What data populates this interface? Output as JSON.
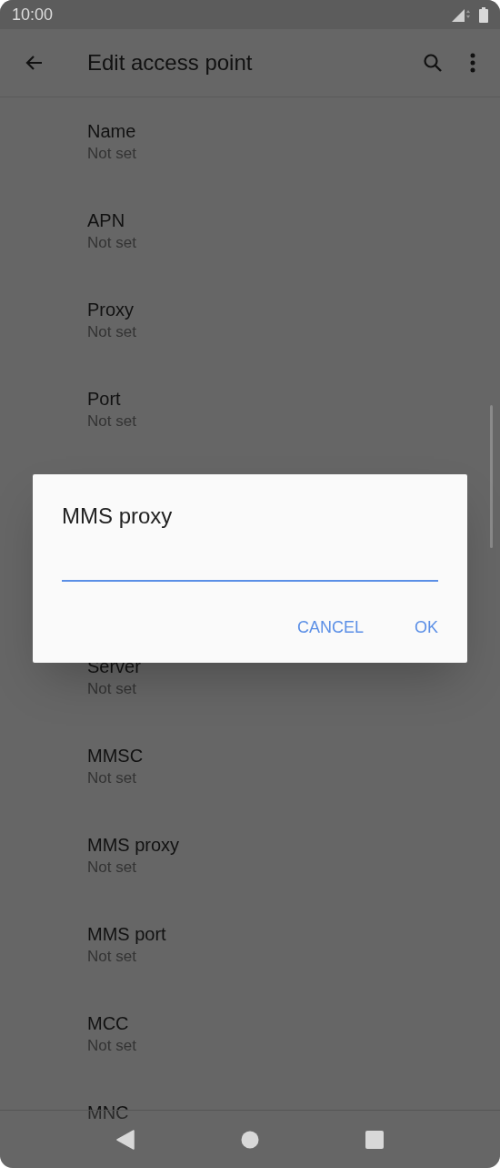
{
  "status_bar": {
    "time": "10:00"
  },
  "app_bar": {
    "title": "Edit access point"
  },
  "settings": [
    {
      "title": "Name",
      "summary": "Not set"
    },
    {
      "title": "APN",
      "summary": "Not set"
    },
    {
      "title": "Proxy",
      "summary": "Not set"
    },
    {
      "title": "Port",
      "summary": "Not set"
    }
  ],
  "settings_below_dialog": [
    {
      "title": "Server",
      "summary": "Not set"
    },
    {
      "title": "MMSC",
      "summary": "Not set"
    },
    {
      "title": "MMS proxy",
      "summary": "Not set"
    },
    {
      "title": "MMS port",
      "summary": "Not set"
    },
    {
      "title": "MCC",
      "summary": "Not set"
    },
    {
      "title": "MNC"
    }
  ],
  "dialog": {
    "title": "MMS proxy",
    "buttons": [
      "CANCEL",
      "OK"
    ]
  }
}
